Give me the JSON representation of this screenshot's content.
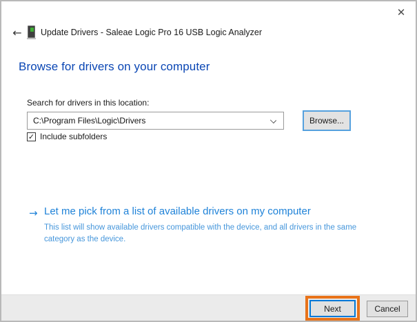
{
  "window": {
    "title": "Update Drivers - Saleae Logic Pro 16 USB Logic Analyzer",
    "close_glyph": "✕",
    "back_glyph": "←",
    "device_icon": "usb-logic-analyzer-device-icon"
  },
  "main": {
    "heading": "Browse for drivers on your computer",
    "search_label": "Search for drivers in this location:",
    "location_combobox": {
      "value": "C:\\Program Files\\Logic\\Drivers",
      "expanded": false
    },
    "browse_button_label": "Browse...",
    "include_subfolders": {
      "label": "Include subfolders",
      "checked": true,
      "check_glyph": "✓"
    },
    "command_link": {
      "arrow_glyph": "→",
      "title": "Let me pick from a list of available drivers on my computer",
      "description": "This list will show available drivers compatible with the device, and all drivers in the same category as the device."
    }
  },
  "footer": {
    "next_label": "Next",
    "cancel_label": "Cancel"
  },
  "annotation": {
    "highlighted_button": "Next",
    "highlight_color": "#e8731a"
  },
  "colors": {
    "heading_blue": "#0a46b4",
    "command_link_blue": "#1e82d8",
    "command_desc_blue": "#4596db",
    "focus_border_blue": "#0078d7",
    "footer_gray": "#ebebeb",
    "dialog_border_gray": "#b9b9b9"
  }
}
